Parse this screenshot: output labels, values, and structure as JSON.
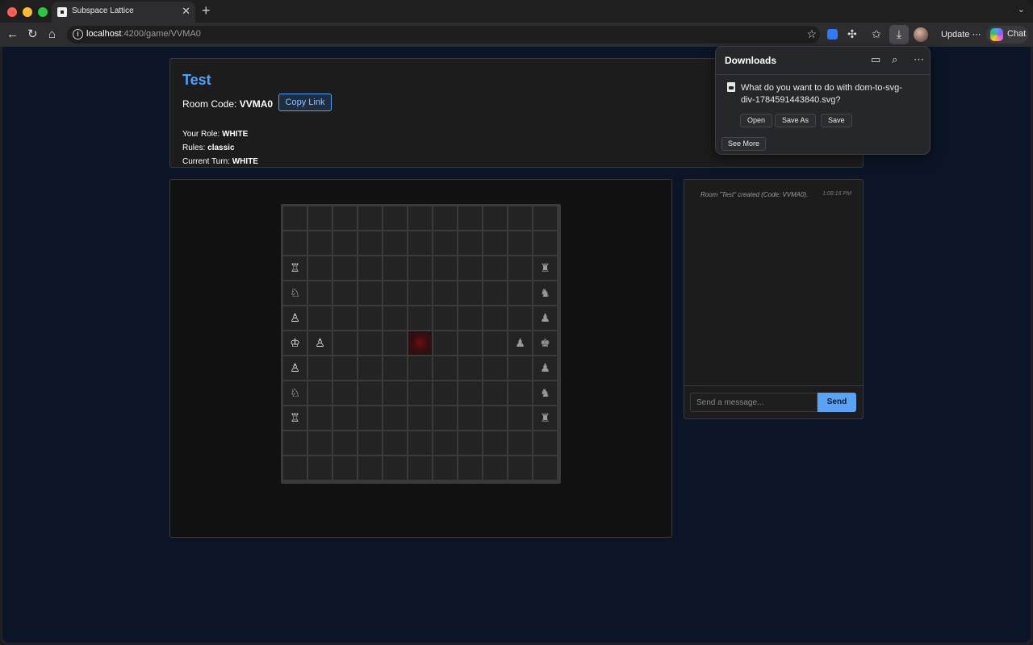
{
  "browser": {
    "tab_title": "Subspace Lattice",
    "url_host": "localhost",
    "url_path": ":4200/game/VVMA0",
    "update_label": "Update",
    "update_more": "⋯",
    "chat_label": "Chat"
  },
  "downloads": {
    "title": "Downloads",
    "question": "What do you want to do with dom-to-svg-div-1784591443840.svg?",
    "actions": [
      "Open",
      "Save As",
      "Save"
    ],
    "see_more": "See More"
  },
  "room": {
    "name": "Test",
    "code_label": "Room Code:",
    "code": "VVMA0",
    "copy_label": "Copy Link",
    "role_label": "Your Role:",
    "role": "WHITE",
    "rules_label": "Rules:",
    "rules": "classic",
    "turn_label": "Current Turn:",
    "turn": "WHITE"
  },
  "board": {
    "size": 11,
    "highlight": [
      5,
      5
    ],
    "pieces": [
      {
        "row": 2,
        "col": 0,
        "glyph": "♖",
        "side": "white",
        "name": "rook"
      },
      {
        "row": 3,
        "col": 0,
        "glyph": "♘",
        "side": "white",
        "name": "knight"
      },
      {
        "row": 4,
        "col": 0,
        "glyph": "♙",
        "side": "white",
        "name": "pawn"
      },
      {
        "row": 5,
        "col": 0,
        "glyph": "♔",
        "side": "white",
        "name": "king"
      },
      {
        "row": 5,
        "col": 1,
        "glyph": "♙",
        "side": "white",
        "name": "pawn"
      },
      {
        "row": 6,
        "col": 0,
        "glyph": "♙",
        "side": "white",
        "name": "pawn"
      },
      {
        "row": 7,
        "col": 0,
        "glyph": "♘",
        "side": "white",
        "name": "knight"
      },
      {
        "row": 8,
        "col": 0,
        "glyph": "♖",
        "side": "white",
        "name": "rook"
      },
      {
        "row": 2,
        "col": 10,
        "glyph": "♜",
        "side": "black",
        "name": "rook"
      },
      {
        "row": 3,
        "col": 10,
        "glyph": "♞",
        "side": "black",
        "name": "knight"
      },
      {
        "row": 4,
        "col": 10,
        "glyph": "♟",
        "side": "black",
        "name": "pawn"
      },
      {
        "row": 5,
        "col": 9,
        "glyph": "♟",
        "side": "black",
        "name": "pawn"
      },
      {
        "row": 5,
        "col": 10,
        "glyph": "♚",
        "side": "black",
        "name": "king"
      },
      {
        "row": 6,
        "col": 10,
        "glyph": "♟",
        "side": "black",
        "name": "pawn"
      },
      {
        "row": 7,
        "col": 10,
        "glyph": "♞",
        "side": "black",
        "name": "knight"
      },
      {
        "row": 8,
        "col": 10,
        "glyph": "♜",
        "side": "black",
        "name": "rook"
      }
    ]
  },
  "chat": {
    "messages": [
      {
        "text": "Room \"Test\" created (Code: VVMA0).",
        "time": "1:08:16 PM"
      }
    ],
    "placeholder": "Send a message...",
    "send_label": "Send"
  },
  "icons": {
    "back": "arrow-left-icon",
    "reload": "reload-icon",
    "home": "home-icon",
    "star": "star-icon",
    "extensions": "puzzle-icon",
    "favorites": "favorites-icon",
    "download": "download-icon",
    "folder": "folder-icon",
    "search": "search-icon",
    "more": "more-icon"
  },
  "colors": {
    "accent": "#4ea1ff",
    "send_button": "#5aa2f5",
    "page_background": "#0c1527",
    "highlight": "#6e0f12"
  }
}
